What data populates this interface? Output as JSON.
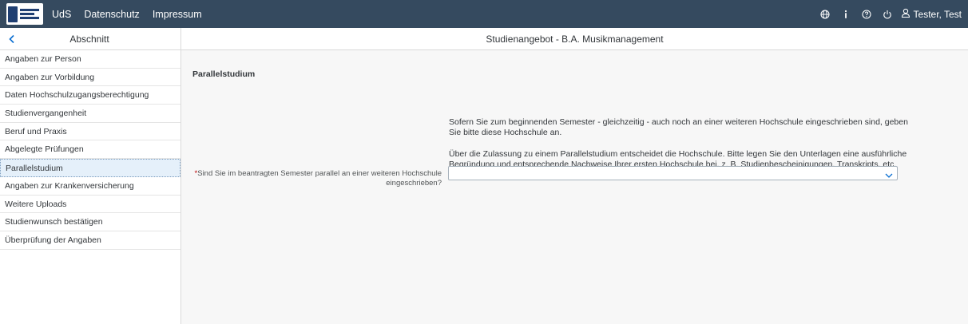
{
  "header": {
    "logo_text": "UNIVERSITÄT DES SAARLANDES",
    "links": [
      "UdS",
      "Datenschutz",
      "Impressum"
    ],
    "icons": [
      "globe-icon",
      "info-icon",
      "help-icon",
      "power-icon",
      "user-icon"
    ],
    "user_name": "Tester, Test",
    "bg_color": "#354a5f"
  },
  "subheader": {
    "left_title": "Abschnitt",
    "right_title": "Studienangebot - B.A. Musikmanagement"
  },
  "sidebar": {
    "items": [
      {
        "label": "Angaben zur Person"
      },
      {
        "label": "Angaben zur Vorbildung"
      },
      {
        "label": "Daten Hochschulzugangsberechtigung"
      },
      {
        "label": "Studienvergangenheit"
      },
      {
        "label": "Beruf und Praxis"
      },
      {
        "label": "Abgelegte Prüfungen"
      },
      {
        "label": "Parallelstudium"
      },
      {
        "label": "Angaben zur Krankenversicherung"
      },
      {
        "label": "Weitere Uploads"
      },
      {
        "label": "Studienwunsch bestätigen"
      },
      {
        "label": "Überprüfung der Angaben"
      }
    ],
    "active": "Parallelstudium"
  },
  "main": {
    "section_title": "Parallelstudium",
    "paragraph1": "Sofern Sie zum beginnenden Semester - gleichzeitig - auch noch an einer weiteren Hochschule eingeschrieben sind, geben Sie bitte diese Hochschule an.",
    "paragraph2": "Über die Zulassung zu einem Parallelstudium entscheidet die Hochschule. Bitte legen Sie den Unterlagen eine ausführliche Begründung und entsprechende Nachweise Ihrer ersten Hochschule bei, z. B. Studienbescheinigungen, Transkripts, etc.",
    "field": {
      "required_mark": "*",
      "label": "Sind Sie im beantragten Semester parallel an einer weiteren Hochschule eingeschrieben?",
      "value": ""
    }
  }
}
